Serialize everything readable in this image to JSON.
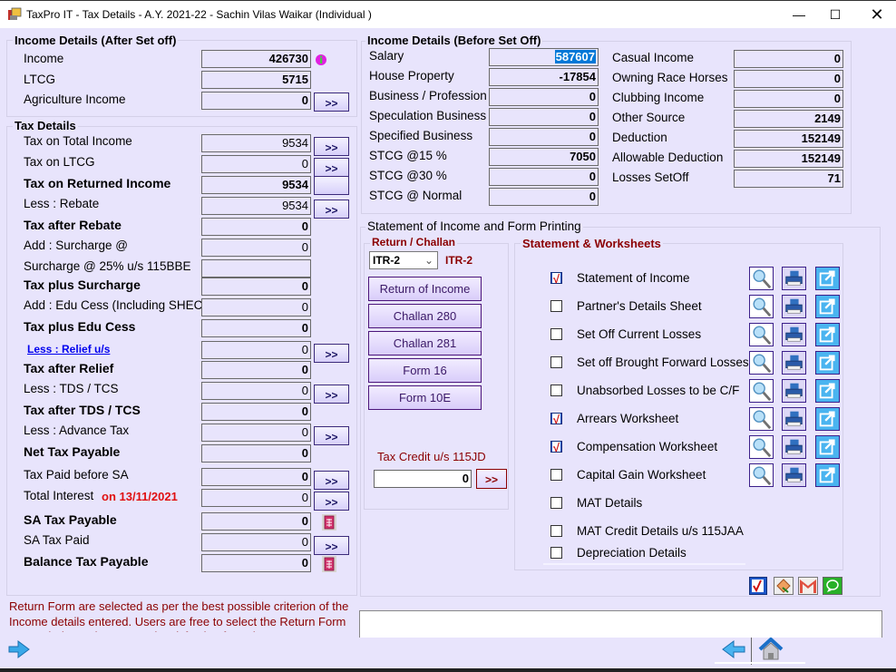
{
  "window": {
    "title": "TaxPro IT - Tax Details - A.Y. 2021-22 - Sachin Vilas Waikar (Individual )",
    "controls": [
      "minimize",
      "maximize",
      "close"
    ]
  },
  "income_after_setoff": {
    "title": "Income Details (After Set off)",
    "rows": [
      {
        "label": "Income",
        "value": "426730"
      },
      {
        "label": "LTCG",
        "value": "5715"
      },
      {
        "label": "Agriculture Income",
        "value": "0"
      }
    ]
  },
  "tax_details": {
    "title": "Tax Details",
    "rows": [
      {
        "label": "Tax on Total Income",
        "value": "9534"
      },
      {
        "label": "Tax on LTCG",
        "value": "0"
      },
      {
        "label": "Tax on Returned Income",
        "value": "9534"
      },
      {
        "label": "Less : Rebate",
        "value": "9534"
      },
      {
        "label": "Tax after Rebate",
        "value": "0"
      },
      {
        "label": "Add : Surcharge   @",
        "value": "0"
      },
      {
        "label": "Surcharge @ 25% u/s 115BBE",
        "value": ""
      },
      {
        "label": "Tax plus Surcharge",
        "value": "0"
      },
      {
        "label": "Add : Edu Cess (Including SHEC)",
        "value": "0"
      },
      {
        "label": "Tax plus Edu Cess",
        "value": "0"
      },
      {
        "label": "Less : Relief u/s",
        "value": "0"
      },
      {
        "label": "Tax after Relief",
        "value": "0"
      },
      {
        "label": "Less : TDS / TCS",
        "value": "0"
      },
      {
        "label": "Tax after TDS / TCS",
        "value": "0"
      },
      {
        "label": "Less : Advance Tax",
        "value": "0"
      },
      {
        "label": "Net Tax Payable",
        "value": "0"
      },
      {
        "label": "Tax Paid before SA",
        "value": "0"
      },
      {
        "label": "Total Interest",
        "value": "0",
        "suffix": "on 13/11/2021"
      },
      {
        "label": "SA Tax Payable",
        "value": "0"
      },
      {
        "label": "SA Tax Paid",
        "value": "0"
      },
      {
        "label": "Balance Tax Payable",
        "value": "0"
      }
    ]
  },
  "income_before_setoff": {
    "title": "Income Details (Before Set Off)",
    "left": [
      {
        "label": "Salary",
        "value": "587607"
      },
      {
        "label": "House Property",
        "value": "-17854"
      },
      {
        "label": "Business / Profession",
        "value": "0"
      },
      {
        "label": "Speculation Business",
        "value": "0"
      },
      {
        "label": "Specified Business",
        "value": "0"
      },
      {
        "label": "STCG @15 %",
        "value": "7050"
      },
      {
        "label": "STCG @30 %",
        "value": "0"
      },
      {
        "label": "STCG @ Normal",
        "value": "0"
      }
    ],
    "right": [
      {
        "label": "Casual Income",
        "value": "0"
      },
      {
        "label": "Owning Race Horses",
        "value": "0"
      },
      {
        "label": "Clubbing Income",
        "value": "0"
      },
      {
        "label": "Other Source",
        "value": "2149"
      },
      {
        "label": "Deduction",
        "value": "152149"
      },
      {
        "label": "Allowable Deduction",
        "value": "152149"
      },
      {
        "label": "Losses SetOff",
        "value": "71"
      }
    ]
  },
  "statement_printing": {
    "title": "Statement of Income and Form Printing",
    "return_challan": {
      "title": "Return / Challan",
      "form_select": "ITR-2",
      "form_label": "ITR-2",
      "buttons": [
        "Return of Income",
        "Challan 280",
        "Challan 281",
        "Form 16",
        "Form 10E"
      ],
      "tax_credit_label": "Tax Credit u/s 115JD",
      "tax_credit_value": "0",
      "more_label": ">>"
    },
    "worksheets": {
      "title": "Statement & Worksheets",
      "items": [
        {
          "label": "Statement of Income",
          "checked": true,
          "actions": true
        },
        {
          "label": "Partner's Details Sheet",
          "checked": false,
          "actions": true
        },
        {
          "label": "Set Off Current Losses",
          "checked": false,
          "actions": true
        },
        {
          "label": "Set off Brought Forward Losses",
          "checked": false,
          "actions": true
        },
        {
          "label": "Unabsorbed Losses to be C/F",
          "checked": false,
          "actions": true
        },
        {
          "label": "Arrears Worksheet",
          "checked": true,
          "actions": true
        },
        {
          "label": "Compensation Worksheet",
          "checked": true,
          "actions": true
        },
        {
          "label": "Capital Gain Worksheet",
          "checked": false,
          "actions": true
        },
        {
          "label": "MAT Details",
          "checked": false,
          "actions": false
        },
        {
          "label": "MAT Credit Details u/s 115JAA",
          "checked": false,
          "actions": false
        },
        {
          "label": "Depreciation Details",
          "checked": false,
          "actions": false
        }
      ]
    }
  },
  "more_button_label": ">>",
  "note": "Return Form are selected as per the best possible criterion of the Income details entered. Users are free to select the Return Form as per their requirement and satisfaction from the",
  "colors": {
    "background": "#e8e4fc",
    "dark_red": "#8b0000",
    "date_red": "#e01010",
    "link_blue": "#0000ee",
    "selection_blue": "#0078d7"
  }
}
